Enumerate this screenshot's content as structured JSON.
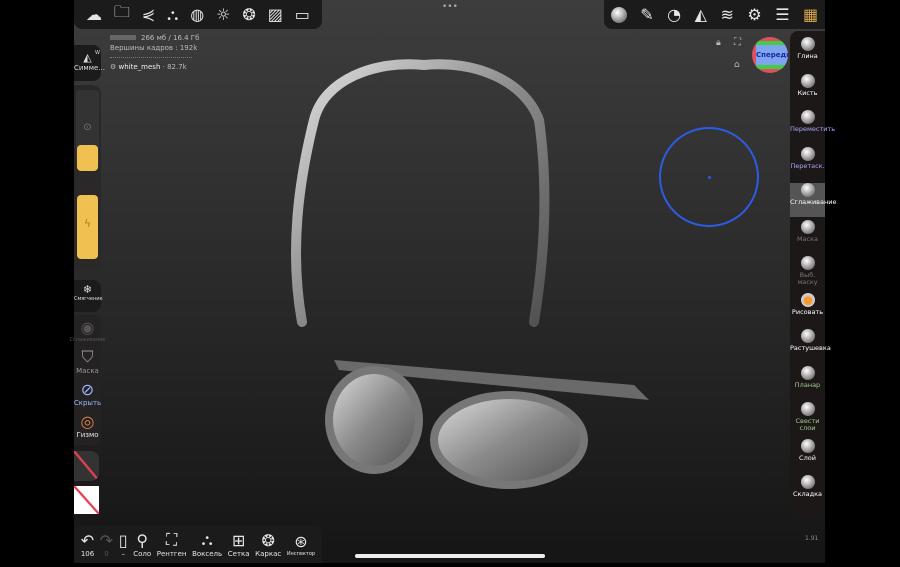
{
  "top_left": {
    "icons": [
      "sculpt-logo-icon",
      "folder-icon",
      "share-icon",
      "scene-icon",
      "globe-icon",
      "light-icon",
      "material-icon",
      "image-icon",
      "video-icon"
    ]
  },
  "top_right": {
    "icons": [
      "brush-preview-icon",
      "pencil-icon",
      "palette-icon",
      "symmetry-icon",
      "layers-icon",
      "settings-icon",
      "sliders-icon",
      "plugin-icon"
    ]
  },
  "info": {
    "memory": "266 мб / 16.4 Гб",
    "vertices": "Вершины кадров : 192k",
    "mesh_name": "white_mesh",
    "mesh_count": " · 82.7k"
  },
  "left": {
    "symmetry": "Симме...",
    "symmetry_badge": "W",
    "smoothing": "Смягчение",
    "smooth_tool": "Сглаживание",
    "mask": "Маска",
    "hide": "Скрыть",
    "gizmo": "Гизмо"
  },
  "gizmo": {
    "front": "Спереди"
  },
  "right_tools": [
    {
      "label": "Глина",
      "color": "#ffffff"
    },
    {
      "label": "Кисть",
      "color": "#ffffff"
    },
    {
      "label": "Переместить",
      "color": "#a8a8ff"
    },
    {
      "label": "Перетаск.",
      "color": "#a8a8ff"
    },
    {
      "label": "Сглаживание",
      "color": "#ffffff"
    },
    {
      "label": "Маска",
      "color": "#777777"
    },
    {
      "label": "Выб. маску",
      "color": "#777777"
    },
    {
      "label": "Рисовать",
      "color": "#ffffff"
    },
    {
      "label": "Растушевка",
      "color": "#ffffff"
    },
    {
      "label": "Планар",
      "color": "#9fd08a"
    },
    {
      "label": "Свести слои",
      "color": "#9fd08a"
    },
    {
      "label": "Слой",
      "color": "#ffffff"
    },
    {
      "label": "Складка",
      "color": "#ffffff"
    }
  ],
  "bottom": {
    "undo_count": "106",
    "redo_count": "0",
    "items": [
      "Соло",
      "Рентген",
      "Воксель",
      "Сетка",
      "Каркас",
      "Инспектор"
    ]
  },
  "version": "1.91",
  "brush_color": "#2d5be3"
}
